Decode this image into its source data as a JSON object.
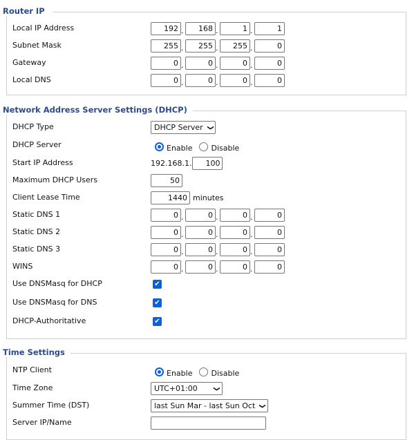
{
  "colors": {
    "legend": "#2d4a8a",
    "accent": "#0b62d6"
  },
  "router_ip": {
    "title": "Router IP",
    "rows": [
      {
        "label": "Local IP Address",
        "type": "ip",
        "octets": [
          "192",
          "168",
          "1",
          "1"
        ]
      },
      {
        "label": "Subnet Mask",
        "type": "ip",
        "octets": [
          "255",
          "255",
          "255",
          "0"
        ]
      },
      {
        "label": "Gateway",
        "type": "ip",
        "octets": [
          "0",
          "0",
          "0",
          "0"
        ]
      },
      {
        "label": "Local DNS",
        "type": "ip",
        "octets": [
          "0",
          "0",
          "0",
          "0"
        ]
      }
    ]
  },
  "dhcp": {
    "title": "Network Address Server Settings (DHCP)",
    "rows": [
      {
        "label": "DHCP Type",
        "type": "select",
        "value": "DHCP Server"
      },
      {
        "label": "DHCP Server",
        "type": "radio",
        "options": [
          "Enable",
          "Disable"
        ],
        "selected": "Enable"
      },
      {
        "label": "Start IP Address",
        "type": "prefix",
        "prefix": "192.168.1.",
        "value": "100"
      },
      {
        "label": "Maximum DHCP Users",
        "type": "input",
        "value": "50"
      },
      {
        "label": "Client Lease Time",
        "type": "input",
        "value": "1440",
        "suffix": "minutes"
      },
      {
        "label": "Static DNS 1",
        "type": "ip",
        "octets": [
          "0",
          "0",
          "0",
          "0"
        ]
      },
      {
        "label": "Static DNS 2",
        "type": "ip",
        "octets": [
          "0",
          "0",
          "0",
          "0"
        ]
      },
      {
        "label": "Static DNS 3",
        "type": "ip",
        "octets": [
          "0",
          "0",
          "0",
          "0"
        ]
      },
      {
        "label": "WINS",
        "type": "ip",
        "octets": [
          "0",
          "0",
          "0",
          "0"
        ]
      },
      {
        "label": "Use DNSMasq for DHCP",
        "type": "checkbox",
        "checked": true
      },
      {
        "label": "Use DNSMasq for DNS",
        "type": "checkbox",
        "checked": true
      },
      {
        "label": "DHCP-Authoritative",
        "type": "checkbox",
        "checked": true
      }
    ]
  },
  "time": {
    "title": "Time Settings",
    "rows": [
      {
        "label": "NTP Client",
        "type": "radio",
        "options": [
          "Enable",
          "Disable"
        ],
        "selected": "Enable"
      },
      {
        "label": "Time Zone",
        "type": "select",
        "value": "UTC+01:00"
      },
      {
        "label": "Summer Time (DST)",
        "type": "select",
        "value": "last Sun Mar - last Sun Oct"
      },
      {
        "label": "Server IP/Name",
        "type": "text",
        "value": ""
      }
    ]
  }
}
